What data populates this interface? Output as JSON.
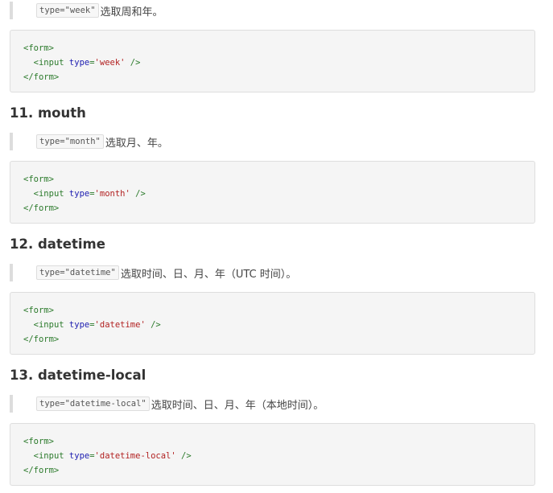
{
  "sections": [
    {
      "heading": "",
      "inline_code": "type=\"week\"",
      "description": "选取周和年。",
      "code": {
        "open_tag": "<form>",
        "input_open": "<input ",
        "attr_name": "type",
        "equals": "=",
        "attr_value": "'week'",
        "input_close": " />",
        "close_tag": "</form>"
      }
    },
    {
      "heading": "11. mouth",
      "inline_code": "type=\"month\"",
      "description": "选取月、年。",
      "code": {
        "open_tag": "<form>",
        "input_open": "<input ",
        "attr_name": "type",
        "equals": "=",
        "attr_value": "'month'",
        "input_close": " />",
        "close_tag": "</form>"
      }
    },
    {
      "heading": "12. datetime",
      "inline_code": "type=\"datetime\"",
      "description": "选取时间、日、月、年（UTC 时间）。",
      "code": {
        "open_tag": "<form>",
        "input_open": "<input ",
        "attr_name": "type",
        "equals": "=",
        "attr_value": "'datetime'",
        "input_close": " />",
        "close_tag": "</form>"
      }
    },
    {
      "heading": "13. datetime-local",
      "inline_code": "type=\"datetime-local\"",
      "description": "选取时间、日、月、年（本地时间）。",
      "code": {
        "open_tag": "<form>",
        "input_open": "<input ",
        "attr_name": "type",
        "equals": "=",
        "attr_value": "'datetime-local'",
        "input_close": " />",
        "close_tag": "</form>"
      }
    }
  ]
}
